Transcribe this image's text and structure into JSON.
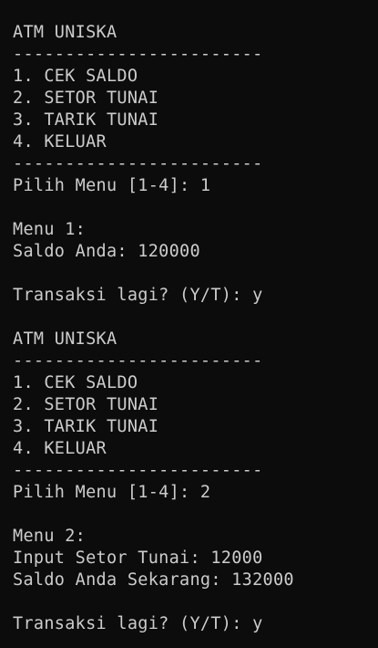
{
  "terminal": {
    "lines": [
      "ATM UNISKA",
      "------------------------",
      "1. CEK SALDO",
      "2. SETOR TUNAI",
      "3. TARIK TUNAI",
      "4. KELUAR",
      "------------------------",
      "Pilih Menu [1-4]: 1",
      "",
      "Menu 1:",
      "Saldo Anda: 120000",
      "",
      "Transaksi lagi? (Y/T): y",
      "",
      "ATM UNISKA",
      "------------------------",
      "1. CEK SALDO",
      "2. SETOR TUNAI",
      "3. TARIK TUNAI",
      "4. KELUAR",
      "------------------------",
      "Pilih Menu [1-4]: 2",
      "",
      "Menu 2:",
      "Input Setor Tunai: 12000",
      "Saldo Anda Sekarang: 132000",
      "",
      "Transaksi lagi? (Y/T): y"
    ]
  }
}
